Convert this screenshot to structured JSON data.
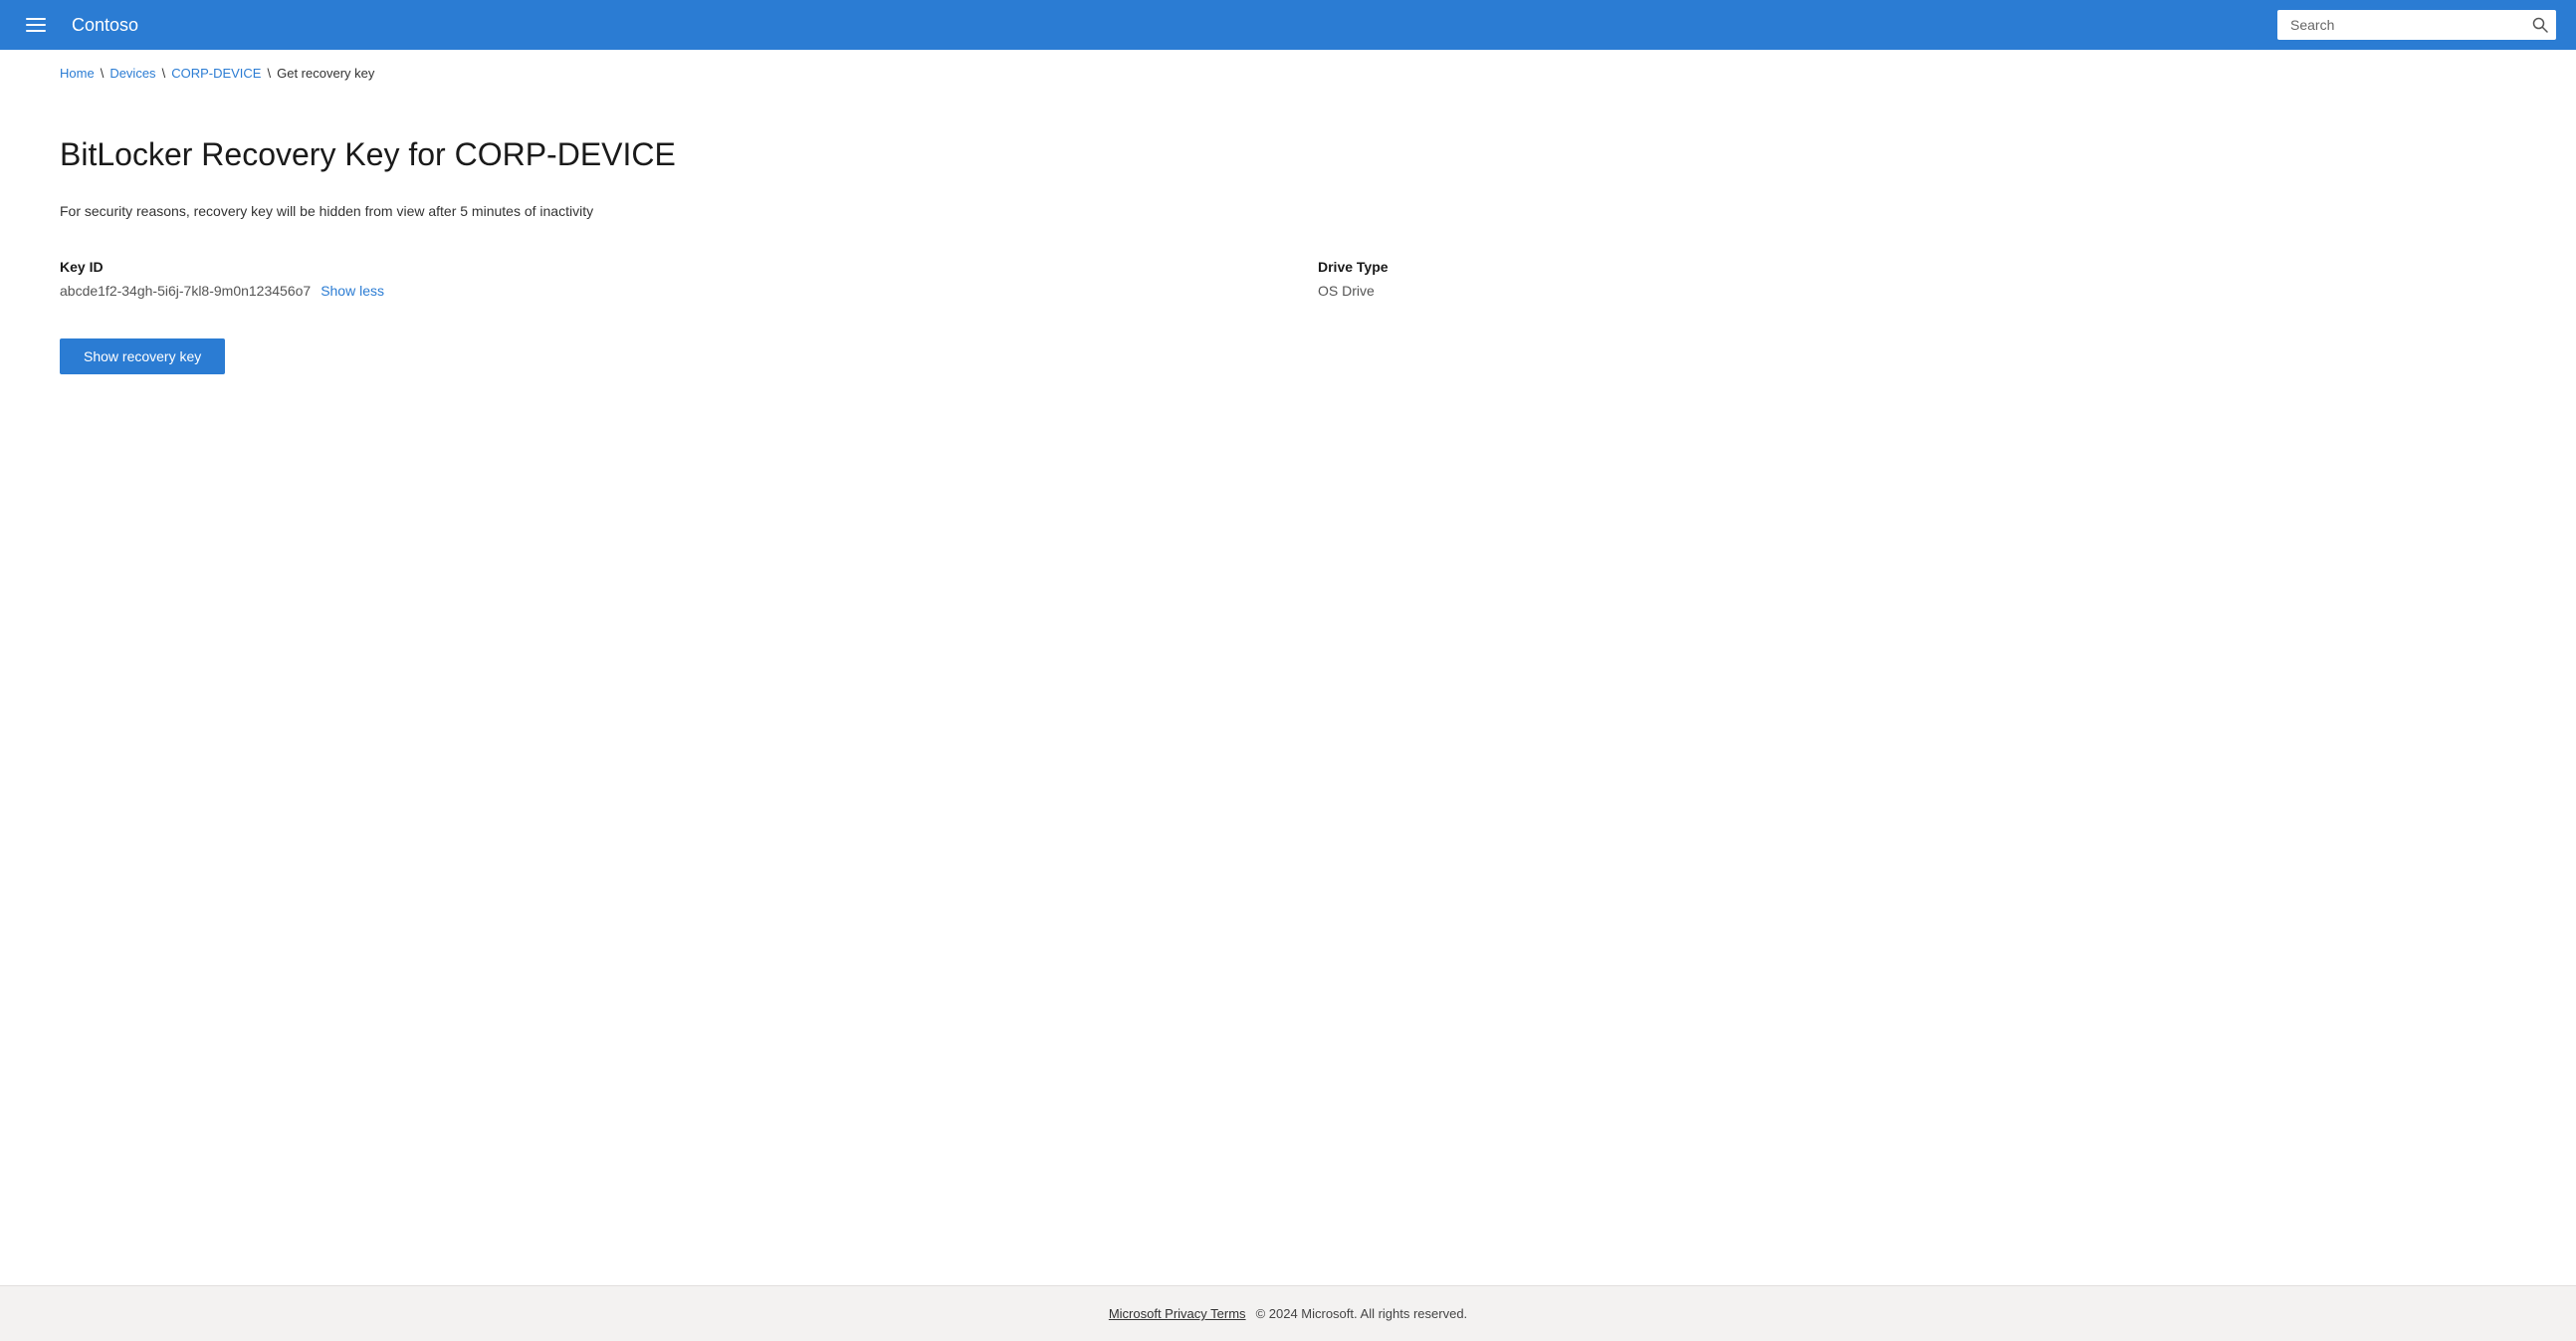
{
  "header": {
    "brand": "Contoso",
    "search_placeholder": "Search",
    "search_icon": "🔍"
  },
  "breadcrumb": {
    "items": [
      {
        "label": "Home",
        "link": true
      },
      {
        "label": "Devices",
        "link": true
      },
      {
        "label": "CORP-DEVICE",
        "link": true
      },
      {
        "label": "Get recovery key",
        "link": false
      }
    ],
    "separators": [
      "\\",
      "\\",
      "\\"
    ]
  },
  "page": {
    "title": "BitLocker Recovery Key for CORP-DEVICE",
    "security_notice": "For security reasons, recovery key will be hidden from view after 5 minutes of inactivity",
    "key_id_label": "Key ID",
    "key_id_value": "abcde1f2-34gh-5i6j-7kl8-9m0n123456o7",
    "show_less_label": "Show less",
    "drive_type_label": "Drive Type",
    "drive_type_value": "OS Drive",
    "show_recovery_key_btn": "Show recovery key"
  },
  "footer": {
    "privacy_link": "Microsoft Privacy Terms",
    "copyright": "© 2024 Microsoft. All rights reserved."
  }
}
